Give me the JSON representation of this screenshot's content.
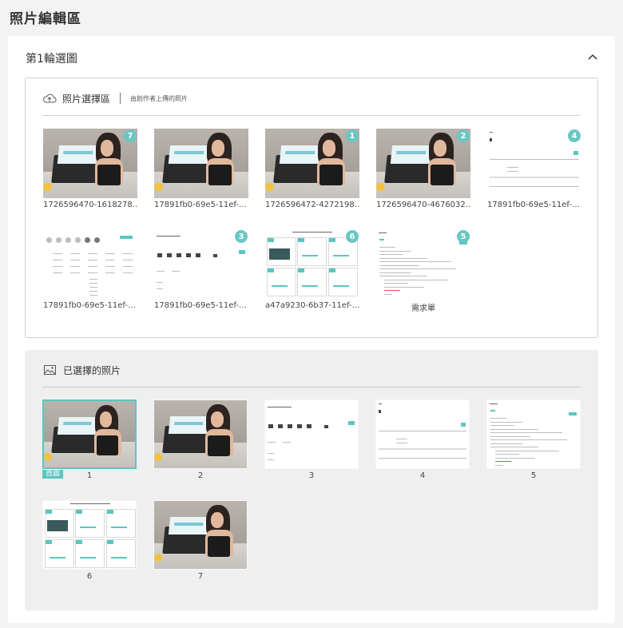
{
  "page_title": "照片編輯區",
  "round": {
    "title": "第1輪選圖",
    "collapse_icon": "chevron-up-icon"
  },
  "picker": {
    "icon": "cloud-upload-icon",
    "title": "照片選擇區",
    "hint": "由創作者上傳的照片",
    "photos": [
      {
        "caption": "1726596470-1618278…",
        "badge": "7",
        "kind": "photo"
      },
      {
        "caption": "17891fb0-69e5-11ef-…",
        "badge": "",
        "kind": "photo"
      },
      {
        "caption": "1726596472-4272198…",
        "badge": "1",
        "kind": "photo"
      },
      {
        "caption": "1726596470-4676032…",
        "badge": "2",
        "kind": "photo"
      },
      {
        "caption": "17891fb0-69e5-11ef-…",
        "badge": "4",
        "kind": "doc-form"
      },
      {
        "caption": "17891fb0-69e5-11ef-…",
        "badge": "",
        "kind": "doc-grid"
      },
      {
        "caption": "17891fb0-69e5-11ef-…",
        "badge": "3",
        "kind": "doc-icons"
      },
      {
        "caption": "a47a9230-6b37-11ef-…",
        "badge": "6",
        "kind": "doc-panels"
      },
      {
        "caption": "需求單",
        "badge": "5",
        "kind": "doc-text"
      }
    ]
  },
  "selected": {
    "icon": "image-icon",
    "title": "已選擇的照片",
    "cover_label": "首圖",
    "photos": [
      {
        "index": "1",
        "kind": "photo"
      },
      {
        "index": "2",
        "kind": "photo"
      },
      {
        "index": "3",
        "kind": "doc-icons"
      },
      {
        "index": "4",
        "kind": "doc-form"
      },
      {
        "index": "5",
        "kind": "doc-text"
      },
      {
        "index": "6",
        "kind": "doc-panels"
      },
      {
        "index": "7",
        "kind": "photo"
      }
    ]
  },
  "colors": {
    "accent": "#5cc5c0",
    "badge": "#6ac7c3",
    "background": "#f3f3f3"
  }
}
